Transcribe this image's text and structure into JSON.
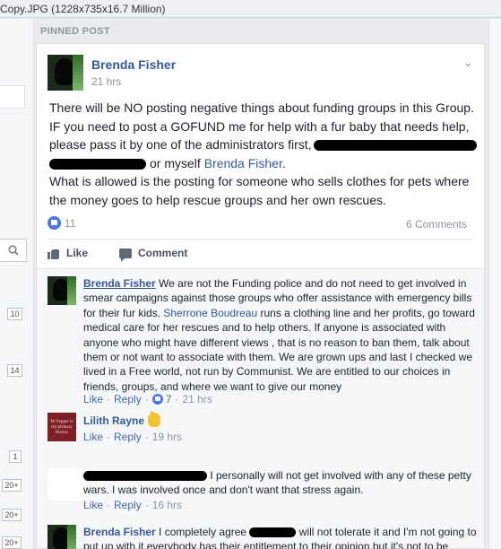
{
  "window": {
    "title": "Copy.JPG (1228x735x16.7 Million)"
  },
  "left_sidebar": {
    "badges": [
      "10",
      "14",
      "1",
      "20+",
      "20+",
      "20+"
    ]
  },
  "pinned_label": "PINNED POST",
  "post": {
    "author": "Brenda Fisher",
    "time": "21 hrs",
    "body": {
      "line1": "There will be NO posting negative things about funding groups in this Group.",
      "line2": "IF you need to post a GOFUND me for help with a fur baby that needs help,",
      "line3": "please pass it by one of the administrators first,",
      "line4_pre": "or myself",
      "line4_link": "Brenda Fisher",
      "line4_post": ".",
      "line5": "What is allowed is the posting for someone who sells clothes for pets where",
      "line6": "the money goes to help rescue groups and her own rescues."
    },
    "likes_count": "11",
    "comments_count": "6 Comments",
    "actions": {
      "like": "Like",
      "comment": "Comment"
    }
  },
  "comments": [
    {
      "author": "Brenda Fisher",
      "text_a": "We are not the Funding police and do not need to get involved in smear campaigns against those groups who offer assistance with emergency bills for their fur kids.",
      "mention": "Sherrone Boudreau",
      "text_b": "runs a clothing line and her profits, go toward medical care for her rescues and to help others. If anyone is associated with anyone who might have different views , that is no reason to ban them, talk about them or not want to associate with them. We are grown ups and last I checked we lived in a Free world, not run by Communist. We are entitled to our choices in friends, groups, and where we want to give our money",
      "like": "Like",
      "reply": "Reply",
      "likes": "7",
      "time": "21 hrs"
    },
    {
      "author": "Lilith Rayne",
      "avatar_text": "Dr Pepper is my primary Doctor.",
      "like": "Like",
      "reply": "Reply",
      "time": "19 hrs"
    },
    {
      "text_a": "I personally will not get involved with any of these",
      "text_b": "petty wars. I was involved once and don't want that stress again.",
      "like": "Like",
      "reply": "Reply",
      "time": "16 hrs"
    },
    {
      "author": "Brenda Fisher",
      "text_a": "I completely agree",
      "text_b": "will not tolerate it and I'm not going to put up with it everybody has their entitlement to their opinion but it's not to be posted on Facebook and I'm not getting involved with it"
    }
  ],
  "colors": {
    "link": "#365899",
    "meta": "#90949c",
    "background": "#e9ebee",
    "like_blue": "#4a77e8",
    "redaction": "#000000"
  }
}
